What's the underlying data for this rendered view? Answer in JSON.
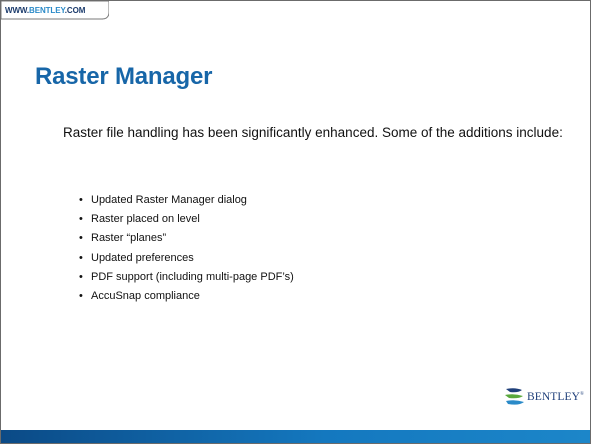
{
  "header": {
    "url_www": "WWW.",
    "url_brand": "BENTLEY",
    "url_com": ".COM",
    "colors": {
      "url_dark": "#1a3a6b",
      "url_brand": "#2a8ac8"
    }
  },
  "slide": {
    "title": "Raster Manager",
    "intro": "Raster file handling has been significantly enhanced. Some of the additions include:",
    "bullets": [
      "Updated Raster Manager dialog",
      "Raster placed on level",
      "Raster “planes”",
      "Updated preferences",
      "PDF support (including multi-page PDF’s)",
      "AccuSnap compliance"
    ],
    "bullet_symbol": "•",
    "colors": {
      "title": "#1766a8",
      "bar": "#1478bf"
    }
  },
  "footer": {
    "logo_text": "BENTLEY",
    "logo_tm": "®",
    "logo_icon": "bentley-b-icon"
  }
}
